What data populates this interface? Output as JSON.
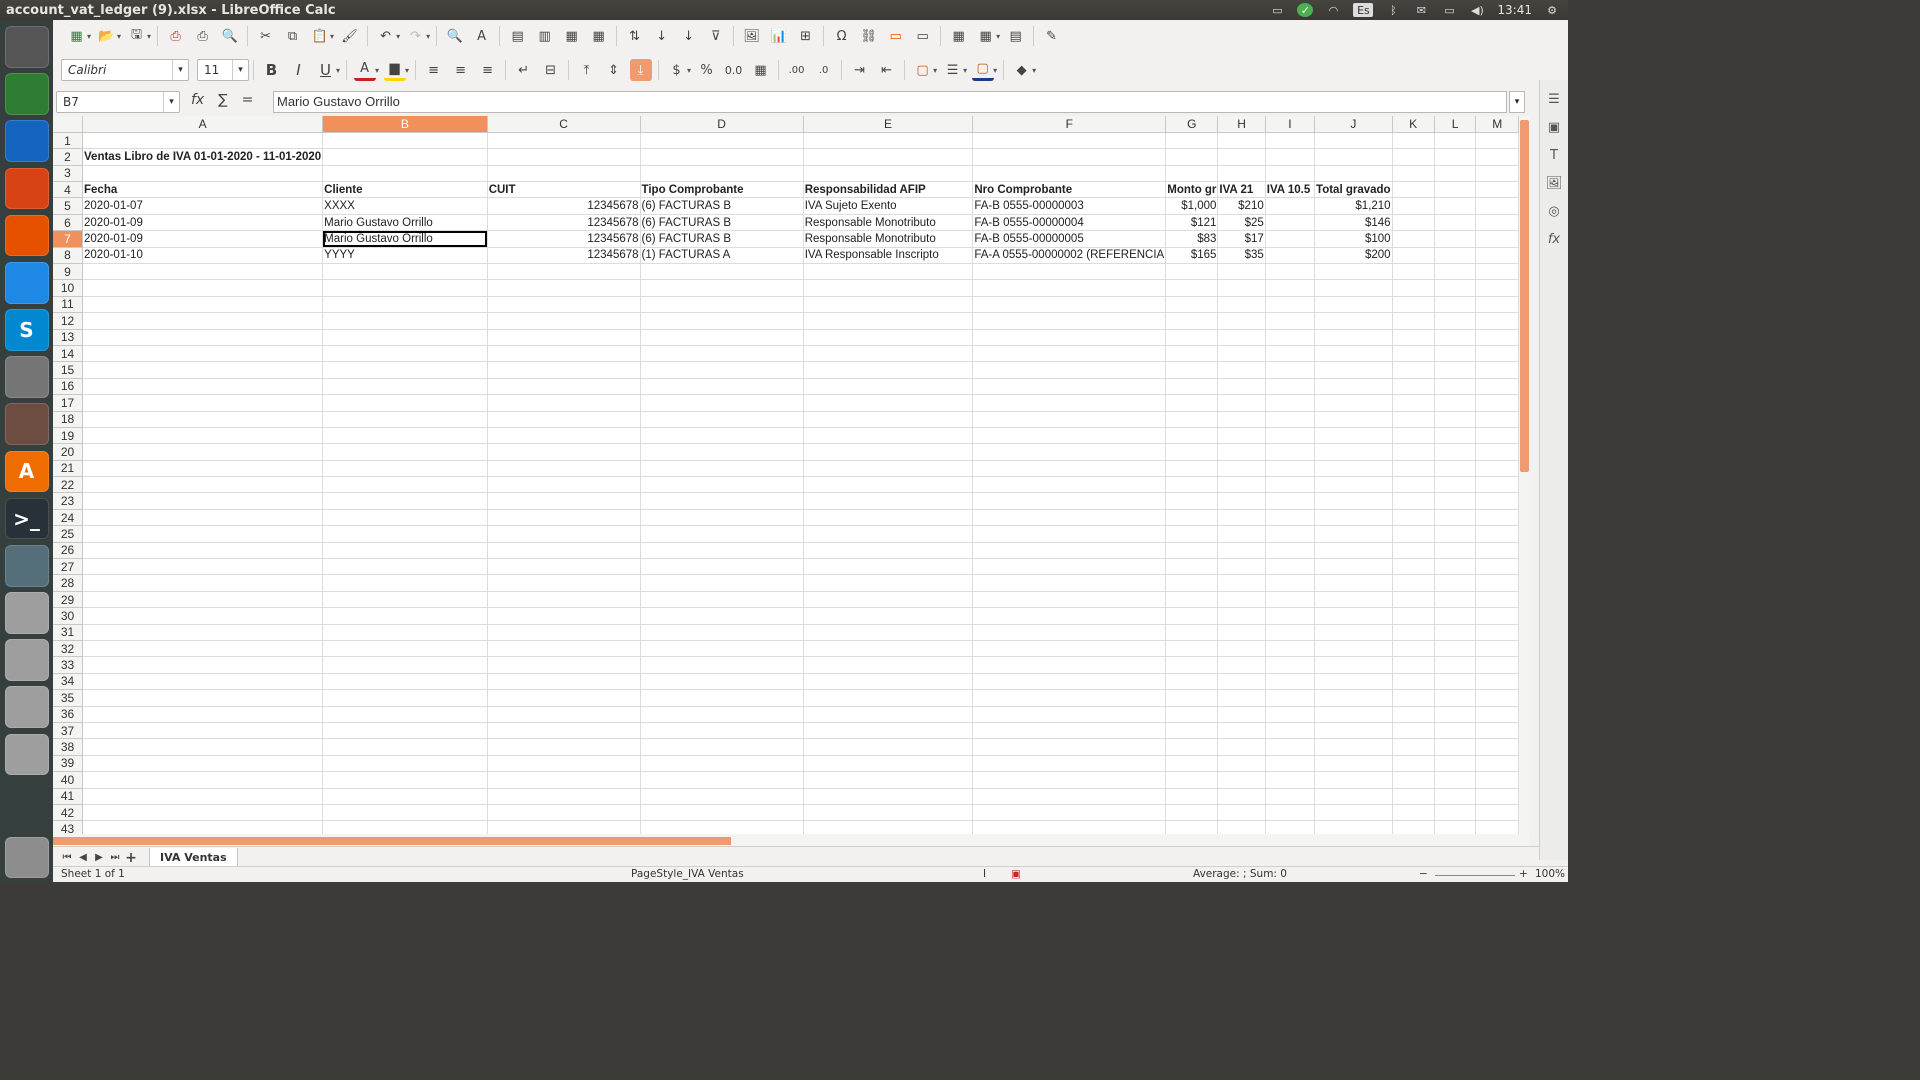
{
  "window": {
    "title": "account_vat_ledger (9).xlsx - LibreOffice Calc"
  },
  "tray": {
    "keyboard": "Es",
    "clock": "13:41"
  },
  "launcher": [
    {
      "name": "dash-icon",
      "label": ""
    },
    {
      "name": "calc-icon",
      "label": ""
    },
    {
      "name": "writer-icon",
      "label": ""
    },
    {
      "name": "impress-icon",
      "label": ""
    },
    {
      "name": "firefox-icon",
      "label": ""
    },
    {
      "name": "chrome-icon",
      "label": ""
    },
    {
      "name": "skype-icon",
      "label": "S"
    },
    {
      "name": "settings-icon",
      "label": ""
    },
    {
      "name": "files-icon",
      "label": ""
    },
    {
      "name": "software-center-icon",
      "label": "A"
    },
    {
      "name": "terminal-icon",
      "label": ">_"
    },
    {
      "name": "screenshot-icon",
      "label": ""
    },
    {
      "name": "drive-icon",
      "label": ""
    },
    {
      "name": "drive-icon",
      "label": ""
    },
    {
      "name": "drive-icon",
      "label": ""
    },
    {
      "name": "drive-icon",
      "label": ""
    },
    {
      "name": "trash-icon",
      "label": ""
    }
  ],
  "toolbar": {
    "font_name": "Calibri",
    "font_size": "11"
  },
  "formula": {
    "cell_ref": "B7",
    "content": "Mario Gustavo Orrillo"
  },
  "columns": [
    {
      "id": "A",
      "w": 178
    },
    {
      "id": "B",
      "w": 178,
      "sel": true
    },
    {
      "id": "C",
      "w": 178
    },
    {
      "id": "D",
      "w": 178
    },
    {
      "id": "E",
      "w": 178
    },
    {
      "id": "F",
      "w": 178
    },
    {
      "id": "G",
      "w": 50
    },
    {
      "id": "H",
      "w": 50
    },
    {
      "id": "I",
      "w": 50
    },
    {
      "id": "J",
      "w": 50
    },
    {
      "id": "K",
      "w": 50
    },
    {
      "id": "L",
      "w": 50
    },
    {
      "id": "M",
      "w": 50
    }
  ],
  "rows": [
    {
      "n": "1",
      "c": []
    },
    {
      "n": "2",
      "c": [
        {
          "t": "Ventas Libro de IVA 01-01-2020 - 11-01-2020",
          "cls": "b ov"
        }
      ]
    },
    {
      "n": "3",
      "c": []
    },
    {
      "n": "4",
      "c": [
        {
          "t": "Fecha",
          "cls": "b"
        },
        {
          "t": "Cliente",
          "cls": "b"
        },
        {
          "t": "CUIT",
          "cls": "b"
        },
        {
          "t": "Tipo Comprobante",
          "cls": "b"
        },
        {
          "t": "Responsabilidad AFIP",
          "cls": "b"
        },
        {
          "t": "Nro Comprobante",
          "cls": "b"
        },
        {
          "t": "Monto gr",
          "cls": "b"
        },
        {
          "t": "IVA 21",
          "cls": "b"
        },
        {
          "t": "IVA 10.5",
          "cls": "b"
        },
        {
          "t": "Total gravado",
          "cls": "b ov"
        }
      ]
    },
    {
      "n": "5",
      "c": [
        {
          "t": "2020-01-07"
        },
        {
          "t": "XXXX"
        },
        {
          "t": "12345678",
          "cls": "num"
        },
        {
          "t": "(6) FACTURAS B"
        },
        {
          "t": "IVA Sujeto Exento"
        },
        {
          "t": "FA-B 0555-00000003"
        },
        {
          "t": "$1,000",
          "cls": "num"
        },
        {
          "t": "$210",
          "cls": "num"
        },
        {
          "t": ""
        },
        {
          "t": "$1,210",
          "cls": "num"
        }
      ]
    },
    {
      "n": "6",
      "c": [
        {
          "t": "2020-01-09"
        },
        {
          "t": "Mario Gustavo Orrillo"
        },
        {
          "t": "12345678",
          "cls": "num"
        },
        {
          "t": "(6) FACTURAS B"
        },
        {
          "t": "Responsable Monotributo"
        },
        {
          "t": "FA-B 0555-00000004"
        },
        {
          "t": "$121",
          "cls": "num"
        },
        {
          "t": "$25",
          "cls": "num"
        },
        {
          "t": ""
        },
        {
          "t": "$146",
          "cls": "num"
        }
      ]
    },
    {
      "n": "7",
      "sel": true,
      "c": [
        {
          "t": "2020-01-09"
        },
        {
          "t": "Mario Gustavo Orrillo",
          "cls": "cur"
        },
        {
          "t": "12345678",
          "cls": "num"
        },
        {
          "t": "(6) FACTURAS B"
        },
        {
          "t": "Responsable Monotributo"
        },
        {
          "t": "FA-B 0555-00000005"
        },
        {
          "t": "$83",
          "cls": "num"
        },
        {
          "t": "$17",
          "cls": "num"
        },
        {
          "t": ""
        },
        {
          "t": "$100",
          "cls": "num"
        }
      ]
    },
    {
      "n": "8",
      "c": [
        {
          "t": "2020-01-10"
        },
        {
          "t": "YYYY"
        },
        {
          "t": "12345678",
          "cls": "num"
        },
        {
          "t": "(1) FACTURAS A"
        },
        {
          "t": "IVA Responsable Inscripto"
        },
        {
          "t": "FA-A 0555-00000002 (REFERENCIA"
        },
        {
          "t": "$165",
          "cls": "num"
        },
        {
          "t": "$35",
          "cls": "num"
        },
        {
          "t": ""
        },
        {
          "t": "$200",
          "cls": "num"
        }
      ]
    }
  ],
  "empty_rows_from": 9,
  "empty_rows_to": 43,
  "sheet_tab": "IVA Ventas",
  "status": {
    "sheet": "Sheet 1 of 1",
    "page_style": "PageStyle_IVA Ventas",
    "summary": "Average: ; Sum: 0",
    "zoom": "100%"
  }
}
